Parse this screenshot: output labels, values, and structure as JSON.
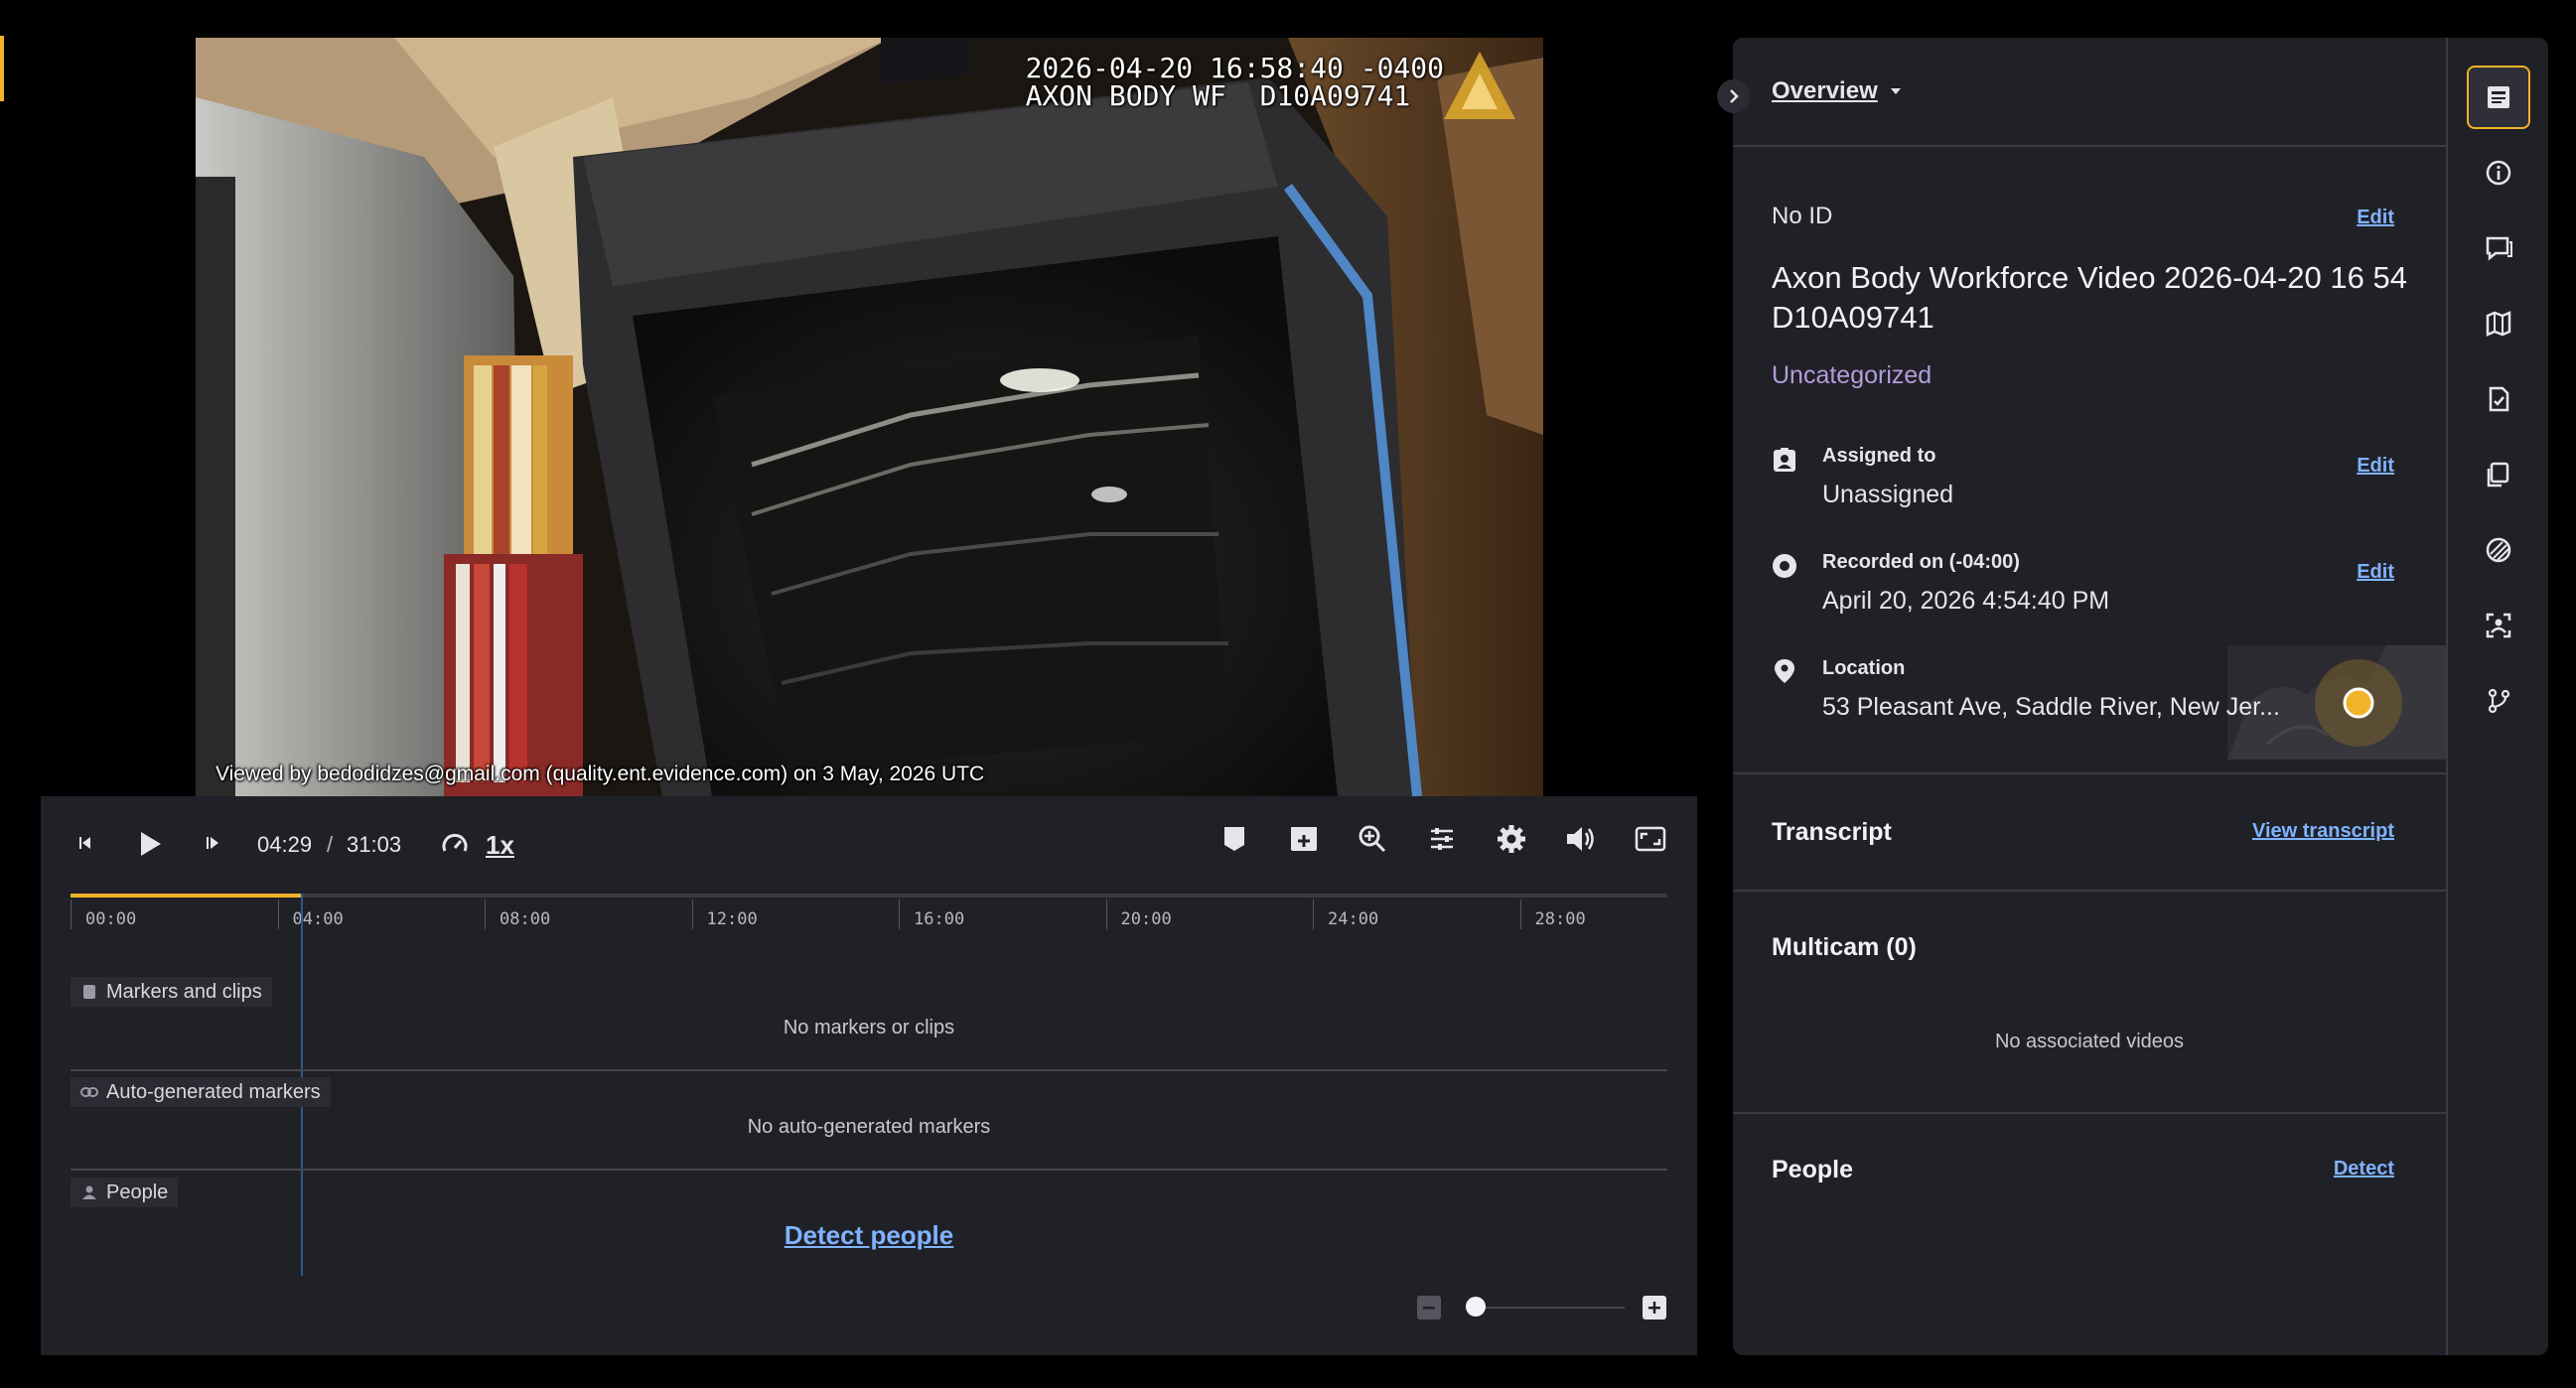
{
  "video": {
    "overlay_timestamp": "2026-04-20 16:58:40 -0400",
    "overlay_device": "AXON BODY WF  D10A09741",
    "viewed_by": "Viewed by bedodidzes@gmail.com (quality.ent.evidence.com) on 3 May, 2026 UTC"
  },
  "player": {
    "current_time": "04:29",
    "separator": "/",
    "duration": "31:03",
    "speed": "1x",
    "progress_fraction": 0.1445,
    "ticks": [
      "00:00",
      "04:00",
      "08:00",
      "12:00",
      "16:00",
      "20:00",
      "24:00",
      "28:00"
    ],
    "lanes": {
      "markers_label": "Markers and clips",
      "markers_empty": "No markers or clips",
      "auto_label": "Auto-generated markers",
      "auto_empty": "No auto-generated markers",
      "people_label": "People",
      "people_action": "Detect people"
    },
    "zoom_fraction": 0.0
  },
  "details": {
    "tab": "Overview",
    "id_label": "No ID",
    "edit_label": "Edit",
    "title": "Axon Body Workforce Video 2026-04-20 16 54 D10A09741",
    "category": "Uncategorized",
    "assigned_label": "Assigned to",
    "assigned_value": "Unassigned",
    "recorded_label": "Recorded on (-04:00)",
    "recorded_value": "April 20, 2026 4:54:40 PM",
    "location_label": "Location",
    "location_value": "53 Pleasant Ave, Saddle River, New Jer...",
    "transcript_label": "Transcript",
    "transcript_action": "View transcript",
    "multicam_label": "Multicam (0)",
    "multicam_empty": "No associated videos",
    "people_label": "People",
    "people_action": "Detect"
  },
  "rail": {
    "icons": [
      "overview-icon",
      "info-icon",
      "comments-icon",
      "map-icon",
      "audit-log-icon",
      "copies-icon",
      "redaction-icon",
      "face-detect-icon",
      "branch-icon"
    ]
  },
  "colors": {
    "accent": "#f0b429",
    "link": "#7fb3ff",
    "panel": "#202027"
  }
}
